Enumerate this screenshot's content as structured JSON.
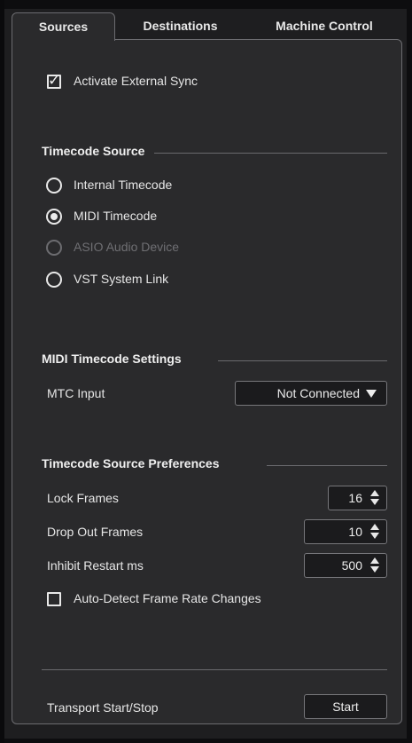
{
  "tabs": [
    {
      "label": "Sources",
      "active": true
    },
    {
      "label": "Destinations",
      "active": false
    },
    {
      "label": "Machine Control",
      "active": false
    }
  ],
  "activate_external_sync": {
    "label": "Activate External Sync",
    "checked": true
  },
  "timecode_source": {
    "title": "Timecode Source",
    "options": [
      {
        "label": "Internal Timecode",
        "selected": false,
        "disabled": false
      },
      {
        "label": "MIDI Timecode",
        "selected": true,
        "disabled": false
      },
      {
        "label": "ASIO Audio Device",
        "selected": false,
        "disabled": true
      },
      {
        "label": "VST System Link",
        "selected": false,
        "disabled": false
      }
    ]
  },
  "midi_timecode_settings": {
    "title": "MIDI Timecode Settings",
    "mtc_input_label": "MTC Input",
    "mtc_input_value": "Not Connected"
  },
  "timecode_source_preferences": {
    "title": "Timecode Source Preferences",
    "lock_frames_label": "Lock Frames",
    "lock_frames_value": "16",
    "drop_out_frames_label": "Drop Out Frames",
    "drop_out_frames_value": "10",
    "inhibit_restart_label": "Inhibit Restart ms",
    "inhibit_restart_value": "500",
    "auto_detect": {
      "label": "Auto-Detect Frame Rate Changes",
      "checked": false
    }
  },
  "transport": {
    "label": "Transport Start/Stop",
    "button_label": "Start"
  },
  "icons": {
    "checkmark": "✓"
  },
  "colors": {
    "panel_bg": "#2a2a2c",
    "outer_bg": "#1e1e20",
    "text": "#e6e6e6",
    "disabled_text": "#6f6f73",
    "border": "#77777b"
  }
}
